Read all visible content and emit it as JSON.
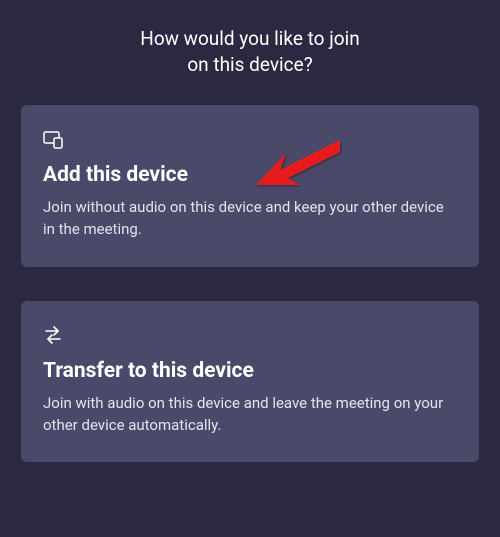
{
  "heading": "How would you like to join\non this device?",
  "options": [
    {
      "title": "Add this device",
      "description": "Join without audio on this device and keep your other device in the meeting."
    },
    {
      "title": "Transfer to this device",
      "description": "Join with audio on this device and leave the meeting on your other device automatically."
    }
  ]
}
